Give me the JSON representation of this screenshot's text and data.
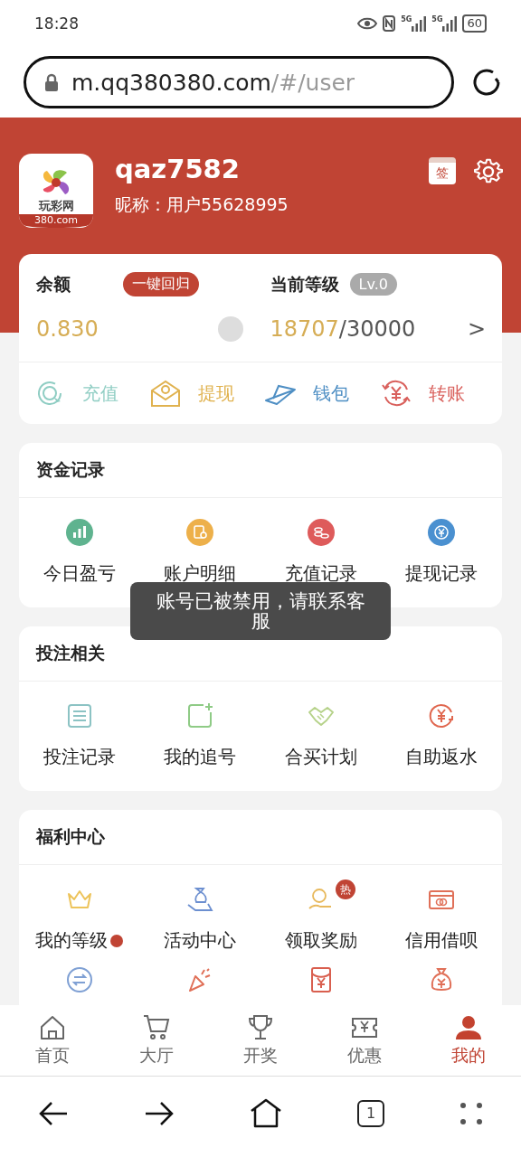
{
  "status_bar": {
    "time": "18:28",
    "network": [
      "5G",
      "5G"
    ],
    "battery": "60"
  },
  "url_bar": {
    "host": "m.qq380380.com",
    "path": "/#/user"
  },
  "profile": {
    "logo_name": "玩彩网",
    "logo_domain": "380.com",
    "username": "qaz7582",
    "nickname_label": "昵称：",
    "nickname": "用户55628995",
    "sign_in_mark": "签"
  },
  "account": {
    "balance_label": "余额",
    "return_button": "一键回归",
    "balance": "0.830",
    "level_label": "当前等级",
    "level_badge": "Lv.0",
    "points": "18707",
    "points_total": "/30000",
    "more": ">"
  },
  "actions": [
    {
      "label": "充值",
      "kind": "recharge",
      "color": "#8fcdc3"
    },
    {
      "label": "提现",
      "kind": "withdraw",
      "color": "#e0b24f"
    },
    {
      "label": "钱包",
      "kind": "wallet",
      "color": "#4f8fc4"
    },
    {
      "label": "转账",
      "kind": "transfer",
      "color": "#d9605c"
    }
  ],
  "sections": [
    {
      "title": "资金记录",
      "items": [
        {
          "label": "今日盈亏",
          "kind": "chart",
          "color": "#5fb38f"
        },
        {
          "label": "账户明细",
          "kind": "ledger",
          "color": "#edb04a"
        },
        {
          "label": "充值记录",
          "kind": "coins",
          "color": "#de5b5b"
        },
        {
          "label": "提现记录",
          "kind": "yen",
          "color": "#4a90d0"
        }
      ]
    },
    {
      "title": "投注相关",
      "items": [
        {
          "label": "投注记录",
          "kind": "list",
          "color": "#8cc3c4"
        },
        {
          "label": "我的追号",
          "kind": "add",
          "color": "#8fcb86"
        },
        {
          "label": "合买计划",
          "kind": "handshake",
          "color": "#b6d28a"
        },
        {
          "label": "自助返水",
          "kind": "rebate",
          "color": "#e0674f"
        }
      ]
    },
    {
      "title": "福利中心",
      "items": [
        {
          "label": "我的等级",
          "kind": "crown",
          "color": "#edc45c",
          "dot": true
        },
        {
          "label": "活动中心",
          "kind": "gift",
          "color": "#6c8fd0"
        },
        {
          "label": "领取奖励",
          "kind": "reward",
          "color": "#e8b95c",
          "badge": "热"
        },
        {
          "label": "信用借呗",
          "kind": "card",
          "color": "#e07058"
        },
        {
          "kind": "swap",
          "color": "#7fa0d4"
        },
        {
          "kind": "party",
          "color": "#e07058"
        },
        {
          "kind": "packet",
          "color": "#d95f4f"
        },
        {
          "kind": "bag",
          "color": "#e07058"
        }
      ]
    }
  ],
  "toast": "账号已被禁用，请联系客服",
  "tabs": [
    {
      "label": "首页",
      "kind": "home",
      "selected": false
    },
    {
      "label": "大厅",
      "kind": "cart",
      "selected": false
    },
    {
      "label": "开奖",
      "kind": "trophy",
      "selected": false
    },
    {
      "label": "优惠",
      "kind": "ticket",
      "selected": false
    },
    {
      "label": "我的",
      "kind": "person",
      "selected": true
    }
  ],
  "browser_nav": {
    "tab_count": "1"
  }
}
